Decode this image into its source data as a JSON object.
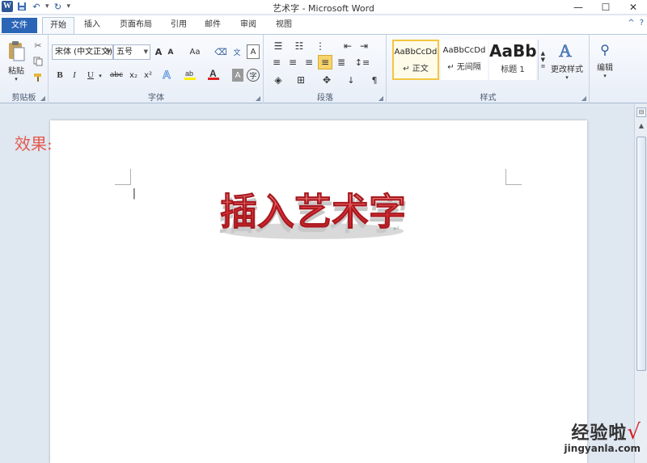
{
  "window": {
    "title": "艺术字 - Microsoft Word",
    "app_icon": "W",
    "minimize": "—",
    "maximize": "☐",
    "close": "✕"
  },
  "tabs": {
    "file": "文件",
    "items": [
      "开始",
      "插入",
      "页面布局",
      "引用",
      "邮件",
      "审阅",
      "视图"
    ]
  },
  "ribbon": {
    "clipboard": {
      "label": "剪贴板",
      "paste": "粘贴"
    },
    "font": {
      "label": "字体",
      "font_name": "宋体 (中文正文)",
      "font_size": "五号",
      "bold": "B",
      "italic": "I",
      "underline": "U",
      "strike": "abc",
      "subscript": "x₂",
      "superscript": "x²",
      "grow": "A",
      "shrink": "A",
      "case": "Aa"
    },
    "paragraph": {
      "label": "段落"
    },
    "styles": {
      "label": "样式",
      "items": [
        {
          "sample": "AaBbCcDd",
          "name": "↵ 正文",
          "selected": true
        },
        {
          "sample": "AaBbCcDd",
          "name": "↵ 无间隔",
          "selected": false
        },
        {
          "sample": "AaBb",
          "name": "标题 1",
          "selected": false
        }
      ],
      "change_styles": "更改样式"
    },
    "editing": {
      "label": "编辑"
    }
  },
  "document": {
    "effect_label": "效果:",
    "wordart_text": "插入艺术字",
    "wordart_color": "#e5343a",
    "cursor": "|",
    "para_mark": "↵"
  },
  "watermark": {
    "main": "经验啦",
    "check": "√",
    "url": "jingyanla.com"
  }
}
